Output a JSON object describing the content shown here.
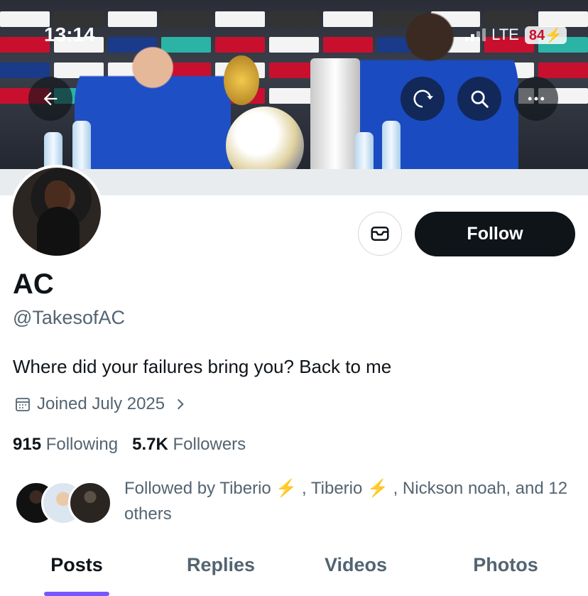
{
  "status_bar": {
    "time": "13:14",
    "network": "LTE",
    "battery": "84"
  },
  "header": {
    "back_icon": "arrow-left-icon",
    "refresh_icon": "refresh-icon",
    "search_icon": "search-icon",
    "more_icon": "more-horizontal-icon"
  },
  "profile": {
    "name": "AC",
    "handle": "@TakesofAC",
    "bio": "Where did your failures bring you? Back to me",
    "joined": "Joined July 2025",
    "following_count": "915",
    "following_label": "Following",
    "followers_count": "5.7K",
    "followers_label": "Followers"
  },
  "actions": {
    "follow_label": "Follow",
    "message_icon": "message-icon"
  },
  "followed_by": {
    "text": "Followed by Tiberio ⚡ , Tiberio ⚡ , Nickson noah, and 12 others"
  },
  "tabs": [
    {
      "label": "Posts"
    },
    {
      "label": "Replies"
    },
    {
      "label": "Videos"
    },
    {
      "label": "Photos"
    }
  ],
  "colors": {
    "follow_bg": "#0f1419",
    "tab_indicator": "#7856ff",
    "secondary_text": "#536471"
  }
}
